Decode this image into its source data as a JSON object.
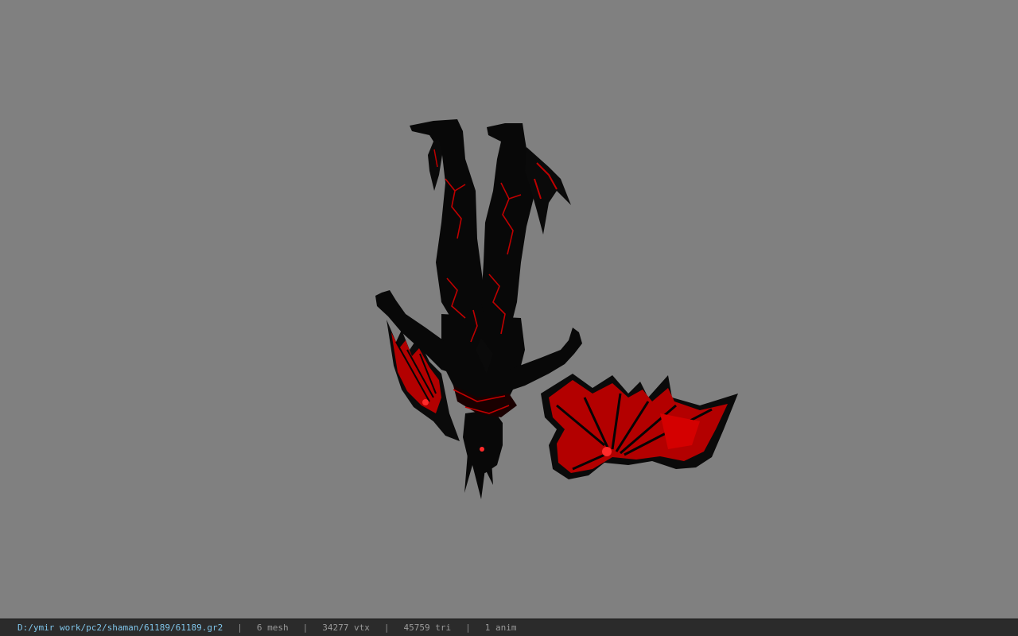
{
  "viewport": {
    "background_color": "#808080",
    "model_colors": {
      "body": "#080808",
      "accent": "#c00000",
      "glow": "#ff2a2a"
    }
  },
  "statusbar": {
    "file_path": "D:/ymir work/pc2/shaman/61189/61189.gr2",
    "separator": "|",
    "mesh": "6 mesh",
    "vertices": "34277 vtx",
    "triangles": "45759 tri",
    "animations": "1 anim"
  }
}
